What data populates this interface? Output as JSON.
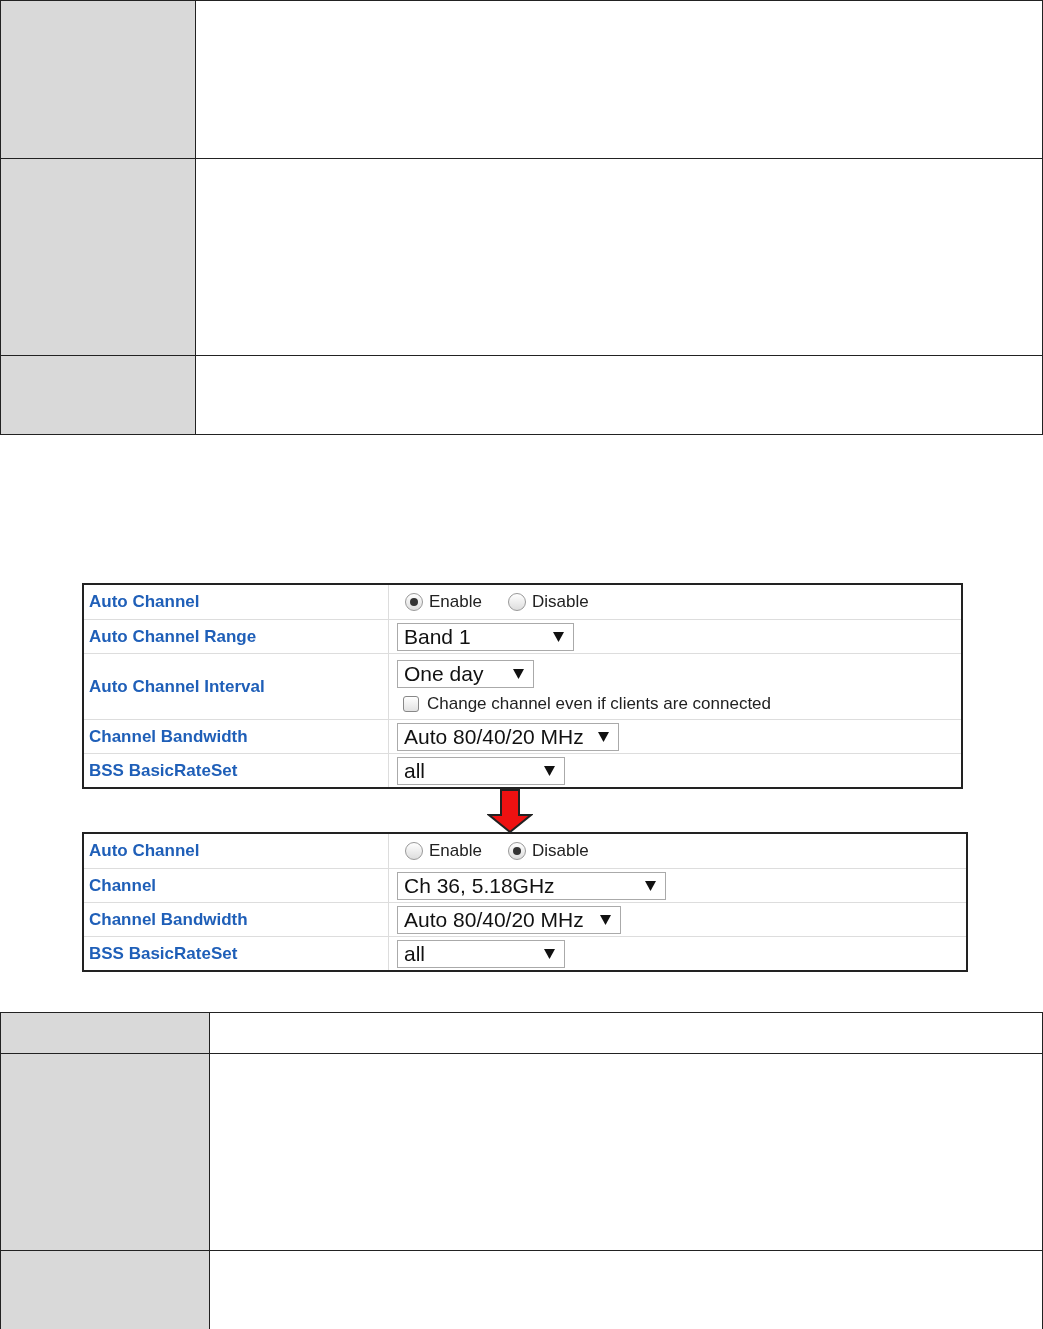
{
  "panels": [
    {
      "rows": [
        {
          "kind": "radio",
          "label": "Auto Channel",
          "options": [
            {
              "label": "Enable",
              "selected": true
            },
            {
              "label": "Disable",
              "selected": false
            }
          ]
        },
        {
          "kind": "select",
          "label": "Auto Channel Range",
          "value": "Band 1"
        },
        {
          "kind": "select_checkbox",
          "label": "Auto Channel Interval",
          "value": "One day",
          "checkbox": {
            "label": "Change channel even if clients are connected",
            "checked": false
          }
        },
        {
          "kind": "select",
          "label": "Channel Bandwidth",
          "value": "Auto 80/40/20 MHz"
        },
        {
          "kind": "select",
          "label": "BSS BasicRateSet",
          "value": "all"
        }
      ]
    },
    {
      "rows": [
        {
          "kind": "radio",
          "label": "Auto Channel",
          "options": [
            {
              "label": "Enable",
              "selected": false
            },
            {
              "label": "Disable",
              "selected": true
            }
          ]
        },
        {
          "kind": "select",
          "label": "Channel",
          "value": "Ch 36, 5.18GHz"
        },
        {
          "kind": "select",
          "label": "Channel Bandwidth",
          "value": "Auto 80/40/20 MHz"
        },
        {
          "kind": "select",
          "label": "BSS BasicRateSet",
          "value": "all"
        }
      ]
    }
  ]
}
